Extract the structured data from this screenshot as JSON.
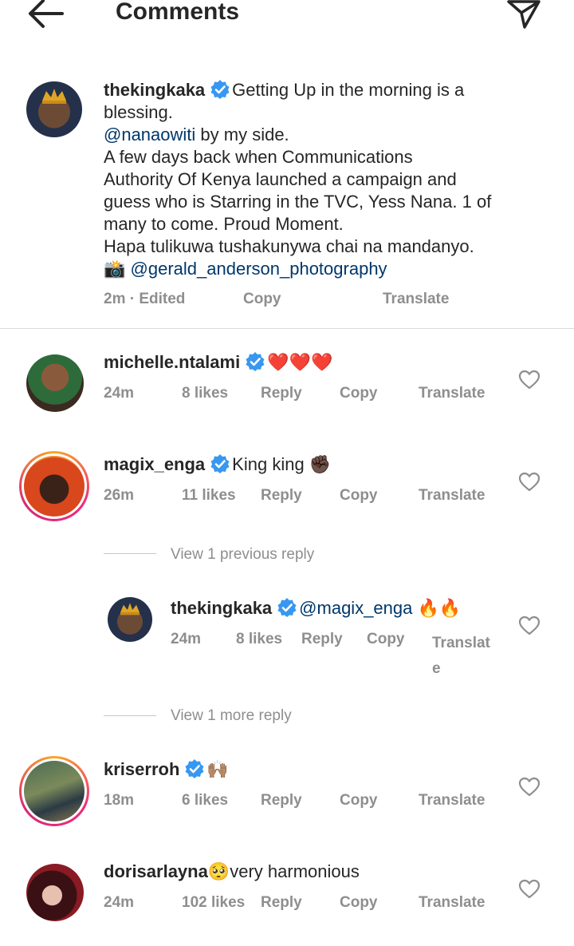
{
  "header": {
    "title": "Comments",
    "back_icon": "arrow-left-icon",
    "share_icon": "send-icon"
  },
  "caption": {
    "username": "thekingkaka",
    "line1": "Getting Up in the morning is a",
    "line2": "blessing.",
    "mention1": "@nanaowiti",
    "line3_rest": " by my side.",
    "line4": "A few days back when Communications",
    "line5": "Authority Of Kenya launched a campaign and",
    "line6": "guess who is Starring in the TVC, Yess Nana. 1 of",
    "line7": "many to come. Proud Moment.",
    "line8": "Hapa tulikuwa tushakunywa chai na mandanyo.",
    "camera": "📸",
    "mention2": "@gerald_anderson_photography",
    "time": "2m · Edited",
    "copy": "Copy",
    "translate": "Translate"
  },
  "comments": [
    {
      "username": "michelle.ntalami",
      "text": "❤️❤️❤️",
      "time": "24m",
      "likes": "8 likes",
      "reply": "Reply",
      "copy": "Copy",
      "translate": "Translate"
    },
    {
      "username": "magix_enga",
      "text": "King king ✊🏿",
      "time": "26m",
      "likes": "11 likes",
      "reply": "Reply",
      "copy": "Copy",
      "translate": "Translate"
    },
    {
      "username": "kriserroh",
      "text": "🙌🏽",
      "time": "18m",
      "likes": "6 likes",
      "reply": "Reply",
      "copy": "Copy",
      "translate": "Translate"
    },
    {
      "username": "dorisarlayna",
      "text": "very harmonious",
      "emoji": "🥺",
      "time": "24m",
      "likes": "102 likes",
      "reply": "Reply",
      "copy": "Copy",
      "translate": "Translate"
    }
  ],
  "view_previous": "View 1 previous reply",
  "reply": {
    "username": "thekingkaka",
    "mention": "@magix_enga",
    "text": " 🔥🔥",
    "time": "24m",
    "likes": "8 likes",
    "reply": "Reply",
    "copy": "Copy",
    "translate_a": "Translat",
    "translate_b": "e"
  },
  "view_more": "View 1 more reply",
  "colors": {
    "verified": "#3897f0",
    "mention": "#00376b",
    "meta": "#8e8e8e"
  }
}
